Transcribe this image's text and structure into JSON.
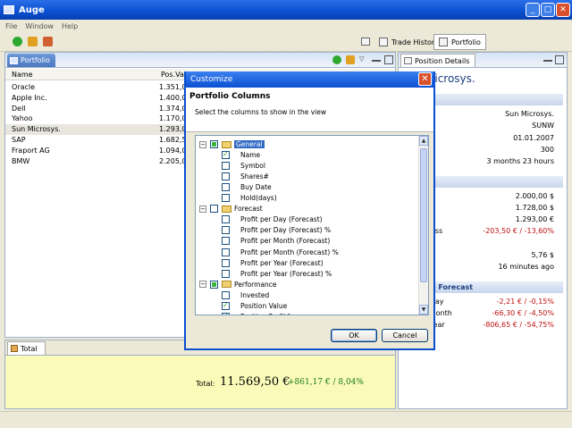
{
  "window": {
    "title": "Auge"
  },
  "menu": [
    "File",
    "Window",
    "Help"
  ],
  "toolbar": {
    "perspectives": [
      {
        "label": "Trade History",
        "selected": false
      },
      {
        "label": "Portfolio",
        "selected": true
      }
    ]
  },
  "portfolio_view": {
    "tab_label": "Portfolio",
    "columns": [
      "Name",
      "Pos.Valu"
    ],
    "rows": [
      {
        "name": "Oracle",
        "value": "1.351,00"
      },
      {
        "name": "Apple Inc.",
        "value": "1.400,00"
      },
      {
        "name": "Dell",
        "value": "1.374,00"
      },
      {
        "name": "Yahoo",
        "value": "1.170,00"
      },
      {
        "name": "Sun Microsys.",
        "value": "1.293,00",
        "selected": true
      },
      {
        "name": "SAP",
        "value": "1.682,50"
      },
      {
        "name": "Fraport AG",
        "value": "1.094,00"
      },
      {
        "name": "BMW",
        "value": "2.205,00"
      }
    ]
  },
  "total_view": {
    "tab_label": "Total",
    "label": "Total:",
    "amount": "11.569,50 €",
    "change": "+861,17 € / 8,04%"
  },
  "position_details": {
    "tab_label": "Position Details",
    "title": "Microsys.",
    "sections": [
      {
        "heading": "eral",
        "items": [
          {
            "label": "",
            "value": "Sun Microsys."
          },
          {
            "label": "",
            "value": "SUNW"
          },
          {
            "label": "e",
            "value": "01.01.2007"
          },
          {
            "label": "",
            "value": "300"
          },
          {
            "label": "",
            "value": "3 months 23 hours"
          }
        ]
      },
      {
        "heading": "rmance",
        "items": [
          {
            "label": "",
            "value": "2.000,00 $"
          },
          {
            "label": "",
            "value": "1.728,00 $"
          },
          {
            "label": "",
            "value": "1.293,00 €"
          },
          {
            "label": "Profit/Loss",
            "value": "-203,50 € / -13,60%",
            "negative": true
          },
          {
            "label": "",
            "value": ""
          },
          {
            "label": "de",
            "value": "5,76 $"
          },
          {
            "label": "me",
            "value": "16 minutes ago"
          }
        ]
      },
      {
        "heading": "rmance Forecast",
        "items": [
          {
            "label": "ss per Day",
            "value": "-2,21 € / -0,15%",
            "negative": true
          },
          {
            "label": "ss per Month",
            "value": "-66,30 € / -4,50%",
            "negative": true
          },
          {
            "label": "ss per Year",
            "value": "-806,65 € / -54,75%",
            "negative": true
          }
        ]
      }
    ]
  },
  "dialog": {
    "title": "Customize",
    "heading": "Portfolio Columns",
    "description": "Select the columns to show in the view",
    "ok_label": "OK",
    "cancel_label": "Cancel",
    "tree": [
      {
        "label": "General",
        "level": 0,
        "state": "partial",
        "selected": true
      },
      {
        "label": "Name",
        "level": 1,
        "state": "checked"
      },
      {
        "label": "Symbol",
        "level": 1,
        "state": "unchecked"
      },
      {
        "label": "Shares#",
        "level": 1,
        "state": "unchecked"
      },
      {
        "label": "Buy Date",
        "level": 1,
        "state": "unchecked"
      },
      {
        "label": "Hold(days)",
        "level": 1,
        "state": "unchecked"
      },
      {
        "label": "Forecast",
        "level": 0,
        "state": "unchecked"
      },
      {
        "label": "Profit per Day (Forecast)",
        "level": 1,
        "state": "unchecked"
      },
      {
        "label": "Profit per Day (Forecast) %",
        "level": 1,
        "state": "unchecked"
      },
      {
        "label": "Profit per Month (Forecast)",
        "level": 1,
        "state": "unchecked"
      },
      {
        "label": "Profit per Month (Forecast) %",
        "level": 1,
        "state": "unchecked"
      },
      {
        "label": "Profit per Year (Forecast)",
        "level": 1,
        "state": "unchecked"
      },
      {
        "label": "Profit per Year (Forecast) %",
        "level": 1,
        "state": "unchecked"
      },
      {
        "label": "Performance",
        "level": 0,
        "state": "partial"
      },
      {
        "label": "Invested",
        "level": 1,
        "state": "unchecked"
      },
      {
        "label": "Position Value",
        "level": 1,
        "state": "checked"
      },
      {
        "label": "Position Profit/Loss",
        "level": 1,
        "state": "checked"
      }
    ]
  },
  "colors": {
    "accent": "#0a4fd0",
    "negative": "#c01010",
    "positive": "#1a7a1a"
  }
}
